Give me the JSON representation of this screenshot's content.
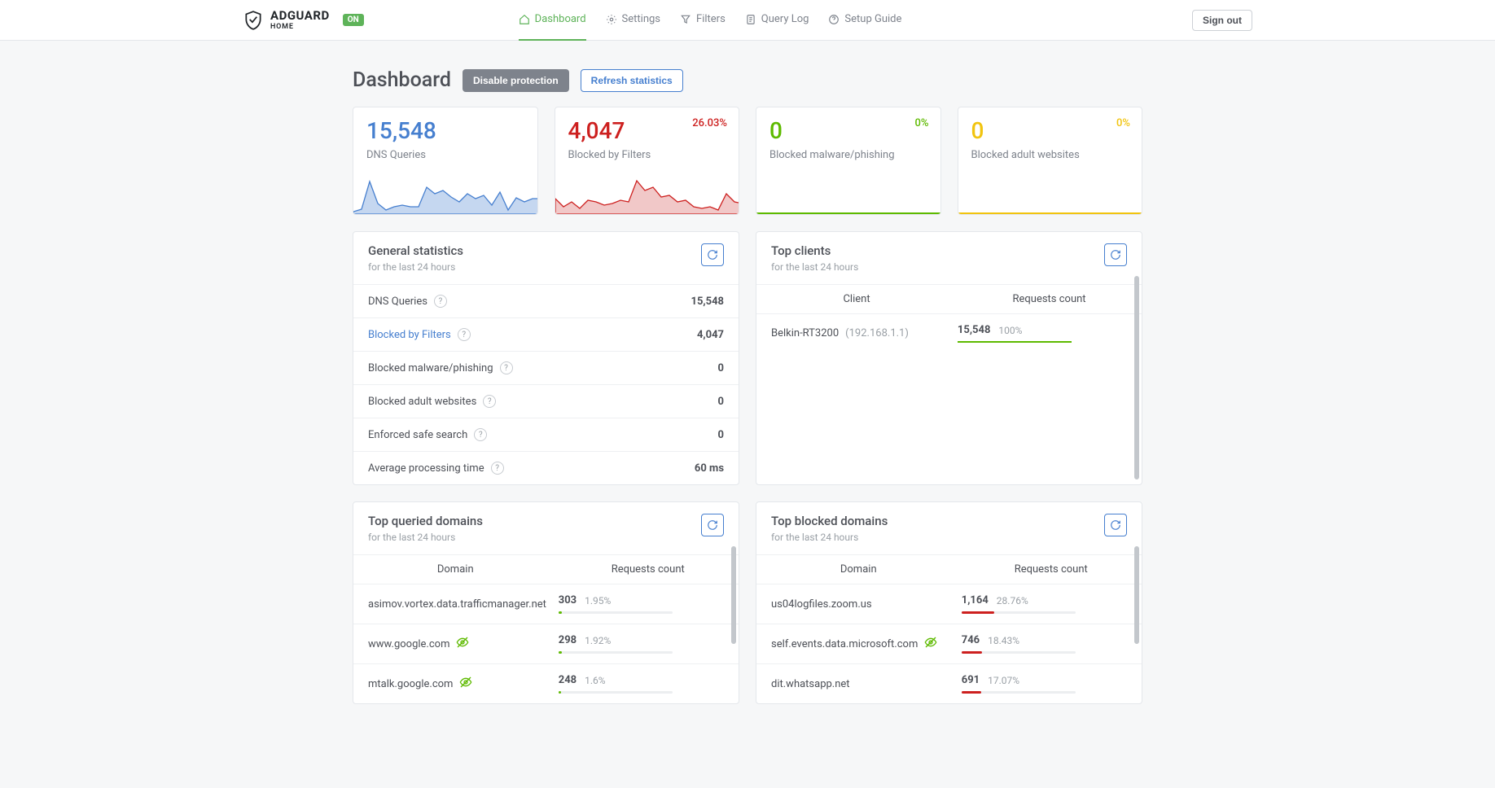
{
  "brand": {
    "name": "ADGUARD",
    "sub": "HOME",
    "status": "ON"
  },
  "nav": {
    "dashboard": "Dashboard",
    "settings": "Settings",
    "filters": "Filters",
    "querylog": "Query Log",
    "setupguide": "Setup Guide"
  },
  "signout": "Sign out",
  "page": {
    "title": "Dashboard",
    "disable_btn": "Disable protection",
    "refresh_btn": "Refresh statistics"
  },
  "stats": {
    "dns": {
      "value": "15,548",
      "label": "DNS Queries"
    },
    "blocked": {
      "value": "4,047",
      "label": "Blocked by Filters",
      "pct": "26.03%"
    },
    "malware": {
      "value": "0",
      "label": "Blocked malware/phishing",
      "pct": "0%"
    },
    "adult": {
      "value": "0",
      "label": "Blocked adult websites",
      "pct": "0%"
    }
  },
  "general": {
    "title": "General statistics",
    "sub": "for the last 24 hours",
    "rows": {
      "dns": {
        "label": "DNS Queries",
        "value": "15,548"
      },
      "blocked": {
        "label": "Blocked by Filters",
        "value": "4,047"
      },
      "malware": {
        "label": "Blocked malware/phishing",
        "value": "0"
      },
      "adult": {
        "label": "Blocked adult websites",
        "value": "0"
      },
      "safe": {
        "label": "Enforced safe search",
        "value": "0"
      },
      "avg": {
        "label": "Average processing time",
        "value": "60 ms"
      }
    }
  },
  "clients": {
    "title": "Top clients",
    "sub": "for the last 24 hours",
    "col1": "Client",
    "col2": "Requests count",
    "rows": [
      {
        "name": "Belkin-RT3200",
        "ip": "(192.168.1.1)",
        "count": "15,548",
        "pct": "100%"
      }
    ]
  },
  "queried": {
    "title": "Top queried domains",
    "sub": "for the last 24 hours",
    "col1": "Domain",
    "col2": "Requests count",
    "rows": [
      {
        "domain": "asimov.vortex.data.trafficmanager.net",
        "count": "303",
        "pct": "1.95%",
        "tracker": false,
        "barw": "3%"
      },
      {
        "domain": "www.google.com",
        "count": "298",
        "pct": "1.92%",
        "tracker": true,
        "barw": "3%"
      },
      {
        "domain": "mtalk.google.com",
        "count": "248",
        "pct": "1.6%",
        "tracker": true,
        "barw": "2.5%"
      }
    ]
  },
  "blocked_domains": {
    "title": "Top blocked domains",
    "sub": "for the last 24 hours",
    "col1": "Domain",
    "col2": "Requests count",
    "rows": [
      {
        "domain": "us04logfiles.zoom.us",
        "count": "1,164",
        "pct": "28.76%",
        "tracker": false,
        "barw": "29%"
      },
      {
        "domain": "self.events.data.microsoft.com",
        "count": "746",
        "pct": "18.43%",
        "tracker": true,
        "barw": "18%"
      },
      {
        "domain": "dit.whatsapp.net",
        "count": "691",
        "pct": "17.07%",
        "tracker": false,
        "barw": "17%"
      }
    ]
  },
  "chart_data": [
    {
      "type": "area",
      "series_name": "DNS Queries",
      "color": "#467fcf",
      "points_y": [
        0,
        3,
        38,
        12,
        4,
        6,
        8,
        7,
        6,
        30,
        22,
        26,
        18,
        12,
        22,
        16,
        20,
        10,
        26,
        5,
        18,
        14,
        18
      ],
      "ylim": [
        0,
        40
      ]
    },
    {
      "type": "area",
      "series_name": "Blocked by Filters",
      "color": "#cd201f",
      "points_y": [
        18,
        8,
        14,
        6,
        16,
        14,
        10,
        12,
        16,
        14,
        40,
        28,
        32,
        20,
        22,
        14,
        16,
        8,
        6,
        8,
        4,
        24,
        14,
        12
      ],
      "ylim": [
        0,
        40
      ]
    }
  ]
}
